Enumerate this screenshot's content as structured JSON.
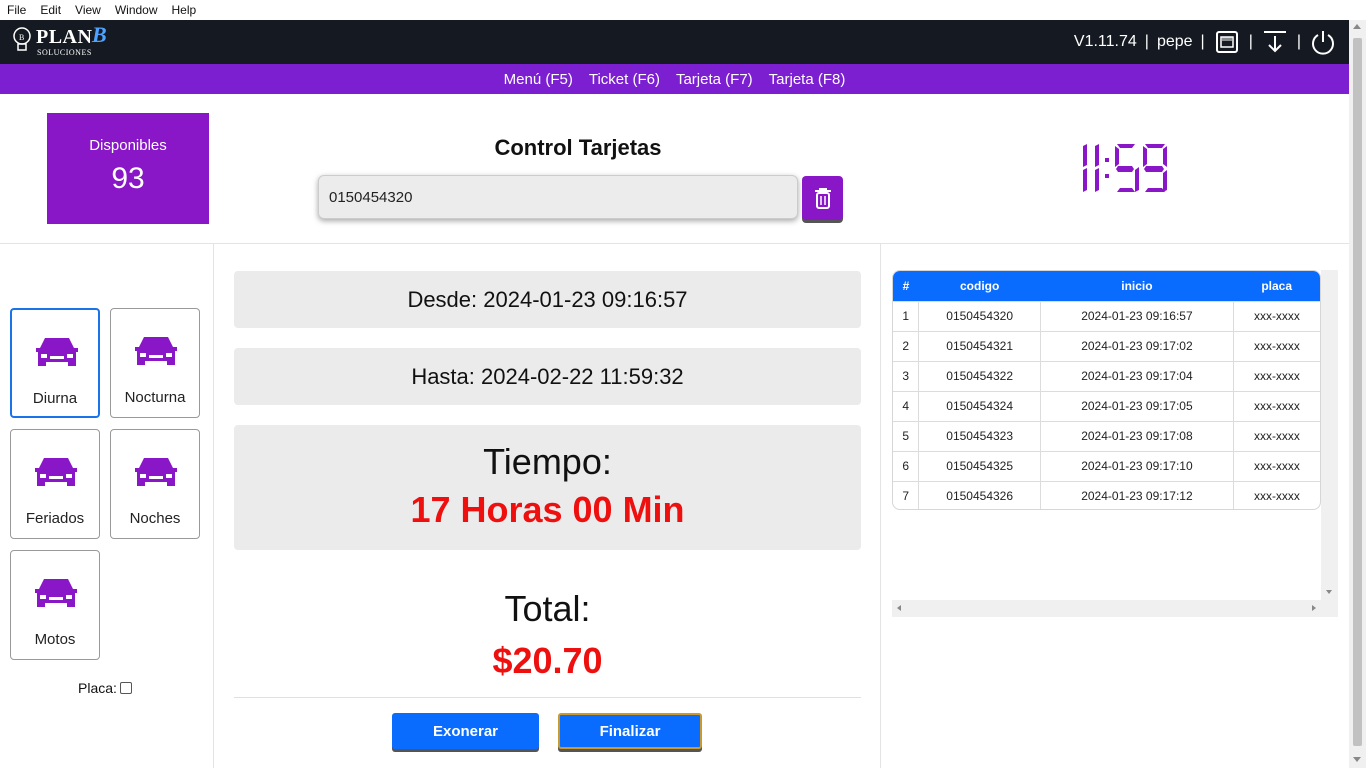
{
  "menubar": {
    "items": [
      "File",
      "Edit",
      "View",
      "Window",
      "Help"
    ]
  },
  "header": {
    "logo_word": "PLAN",
    "logo_b": "B",
    "logo_sub": "SOLUCIONES",
    "version": "V1.11.74",
    "user": "pepe",
    "sep": "|",
    "icons": [
      "network-icon",
      "download-icon",
      "power-icon"
    ]
  },
  "nav": {
    "items": [
      "Menú (F5)",
      "Ticket (F6)",
      "Tarjeta (F7)",
      "Tarjeta (F8)"
    ]
  },
  "disponibles": {
    "label": "Disponibles",
    "count": "93"
  },
  "control": {
    "title": "Control Tarjetas",
    "card_value": "0150454320"
  },
  "clock": {
    "time": "11:59",
    "color": "#8a17c7"
  },
  "vehicle_types": [
    {
      "name": "Diurna",
      "active": true
    },
    {
      "name": "Nocturna",
      "active": false
    },
    {
      "name": "Feriados",
      "active": false
    },
    {
      "name": "Noches",
      "active": false
    },
    {
      "name": "Motos",
      "active": false
    }
  ],
  "placa": {
    "label": "Placa:",
    "checked": false
  },
  "details": {
    "desde": "Desde: 2024-01-23 09:16:57",
    "hasta": "Hasta: 2024-02-22 11:59:32",
    "tiempo_label": "Tiempo:",
    "tiempo_value": "17 Horas 00 Min",
    "total_label": "Total:",
    "total_value": "$20.70"
  },
  "actions": {
    "exonerar": "Exonerar",
    "finalizar": "Finalizar"
  },
  "table": {
    "headers": [
      "#",
      "codigo",
      "inicio",
      "placa"
    ],
    "rows": [
      [
        "1",
        "0150454320",
        "2024-01-23 09:16:57",
        "xxx-xxxx"
      ],
      [
        "2",
        "0150454321",
        "2024-01-23 09:17:02",
        "xxx-xxxx"
      ],
      [
        "3",
        "0150454322",
        "2024-01-23 09:17:04",
        "xxx-xxxx"
      ],
      [
        "4",
        "0150454324",
        "2024-01-23 09:17:05",
        "xxx-xxxx"
      ],
      [
        "5",
        "0150454323",
        "2024-01-23 09:17:08",
        "xxx-xxxx"
      ],
      [
        "6",
        "0150454325",
        "2024-01-23 09:17:10",
        "xxx-xxxx"
      ],
      [
        "7",
        "0150454326",
        "2024-01-23 09:17:12",
        "xxx-xxxx"
      ]
    ]
  },
  "colors": {
    "purple": "#8a17c7",
    "nav_purple": "#7b1fd1",
    "blue": "#0a6cff",
    "red": "#ee0f0f",
    "dark": "#151a22"
  }
}
